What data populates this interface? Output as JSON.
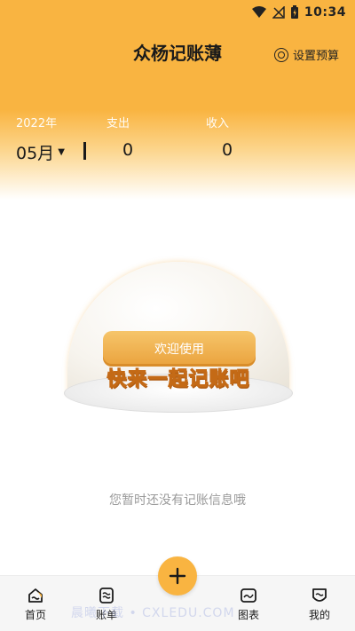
{
  "status_bar": {
    "time": "10:34"
  },
  "header": {
    "title": "众杨记账薄",
    "budget_label": "设置预算"
  },
  "summary": {
    "year_label": "2022年",
    "expense_label": "支出",
    "income_label": "收入",
    "month": "05月",
    "expense_value": "0",
    "income_value": "0"
  },
  "empty_state": {
    "welcome": "欢迎使用",
    "slogan": "快来一起记账吧",
    "hint": "您暂时还没有记账信息哦"
  },
  "bottom_nav": {
    "home": "首页",
    "bills": "账单",
    "charts": "图表",
    "mine": "我的"
  },
  "watermark": "晨曦下载 • CXLEDU.COM",
  "colors": {
    "accent": "#f9b441"
  }
}
